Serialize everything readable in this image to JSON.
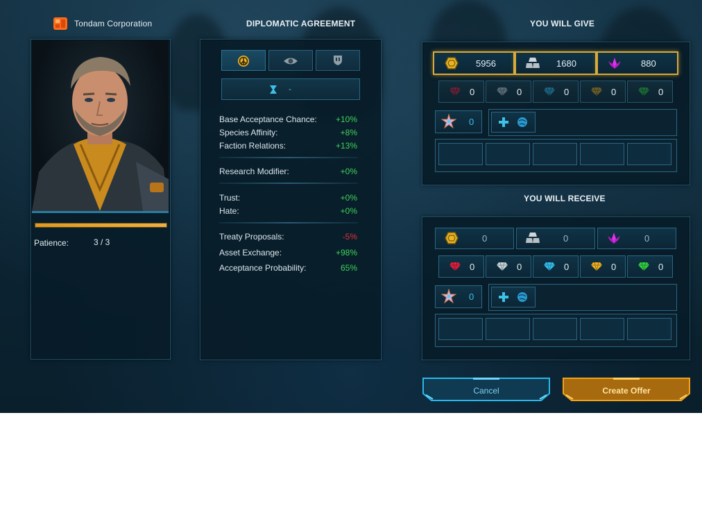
{
  "header": {
    "faction_name": "Tondam Corporation",
    "diplomatic_title": "DIPLOMATIC AGREEMENT",
    "give_title": "YOU WILL GIVE",
    "receive_title": "YOU WILL RECEIVE"
  },
  "leader": {
    "patience_label": "Patience:",
    "patience_value": "3 / 3",
    "patience_fill": 1.0
  },
  "agreement": {
    "duration_value": "-",
    "stats": [
      {
        "label": "Base Acceptance Chance:",
        "value": "+10%"
      },
      {
        "label": "Species Affinity:",
        "value": "+8%"
      },
      {
        "label": "Faction Relations:",
        "value": "+13%"
      },
      {
        "label": "Research Modifier:",
        "value": "+0%"
      },
      {
        "label": "Trust:",
        "value": "+0%"
      },
      {
        "label": "Hate:",
        "value": "+0%"
      },
      {
        "label": "Treaty Proposals:",
        "value": "-5%"
      },
      {
        "label": "Asset Exchange:",
        "value": "+98%"
      },
      {
        "label": "Acceptance Probability:",
        "value": "65%"
      }
    ]
  },
  "give": {
    "credits": "5956",
    "alloys": "1680",
    "crystals": "880",
    "gems": [
      "0",
      "0",
      "0",
      "0",
      "0"
    ],
    "stars": "0"
  },
  "receive": {
    "credits": "0",
    "alloys": "0",
    "crystals": "0",
    "gems": [
      "0",
      "0",
      "0",
      "0",
      "0"
    ],
    "stars": "0"
  },
  "buttons": {
    "cancel": "Cancel",
    "create_offer": "Create Offer"
  },
  "colors": {
    "positive": "#3fd45a",
    "negative": "#e0323a",
    "accent_gold": "#d9a93b",
    "accent_cyan": "#2bb8e8"
  }
}
